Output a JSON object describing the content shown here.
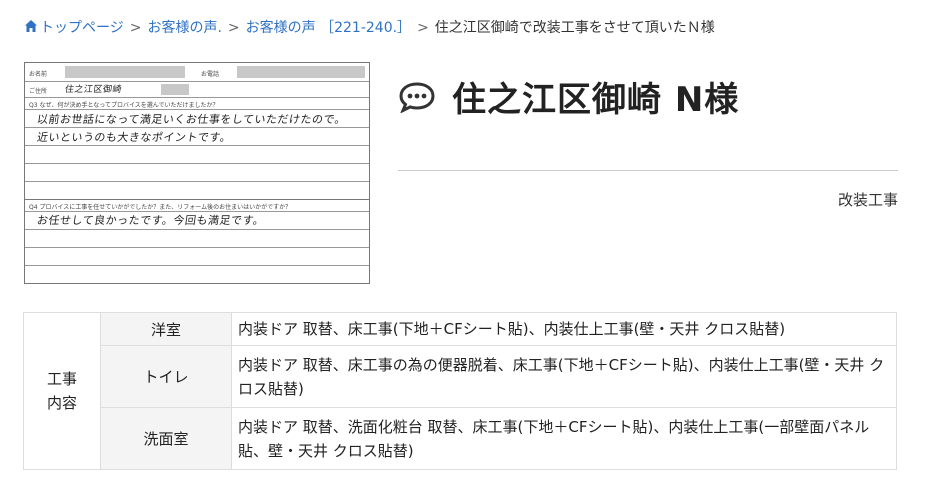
{
  "breadcrumb": {
    "items": [
      {
        "label": "トップページ",
        "link": true
      },
      {
        "label": "お客様の声.",
        "link": true
      },
      {
        "label": "お客様の声 ［221-240.］",
        "link": true
      },
      {
        "label": "住之江区御崎で改装工事をさせて頂いたＮ様",
        "link": false
      }
    ],
    "separator": ">"
  },
  "survey": {
    "name_label": "お名前",
    "surname_label": "お電話",
    "address_label": "ご住所",
    "address_hand": "住之江区御崎",
    "q3": "Q3 なぜ、何が決め手となってプロバイスを選んでいただけましたか？",
    "q3_answer_line1": "以前お世話になって満足いくお仕事をしていただけたので。",
    "q3_answer_line2": "近いというのも大きなポイントです。",
    "q4": "Q4 プロバイスに工事を任せていかがでしたか？また、リフォーム後のお住まいはいかがですか？",
    "q4_answer_line1": "お任せして良かったです。今回も満足です。"
  },
  "header": {
    "title": "住之江区御崎 N様",
    "category": "改装工事"
  },
  "work_table": {
    "main_label": "工事内容",
    "rows": [
      {
        "room": "洋室",
        "content": "内装ドア 取替、床工事(下地＋CFシート貼)、内装仕上工事(壁・天井 クロス貼替)"
      },
      {
        "room": "トイレ",
        "content": "内装ドア 取替、床工事の為の便器脱着、床工事(下地＋CFシート貼)、内装仕上工事(壁・天井 クロス貼替)"
      },
      {
        "room": "洗面室",
        "content": "内装ドア 取替、洗面化粧台 取替、床工事(下地＋CFシート貼)、内装仕上工事(一部壁面パネル貼、壁・天井 クロス貼替)"
      }
    ]
  },
  "colors": {
    "link": "#2f72c4",
    "border": "#dddddd",
    "label_bg": "#f4f4f4"
  }
}
